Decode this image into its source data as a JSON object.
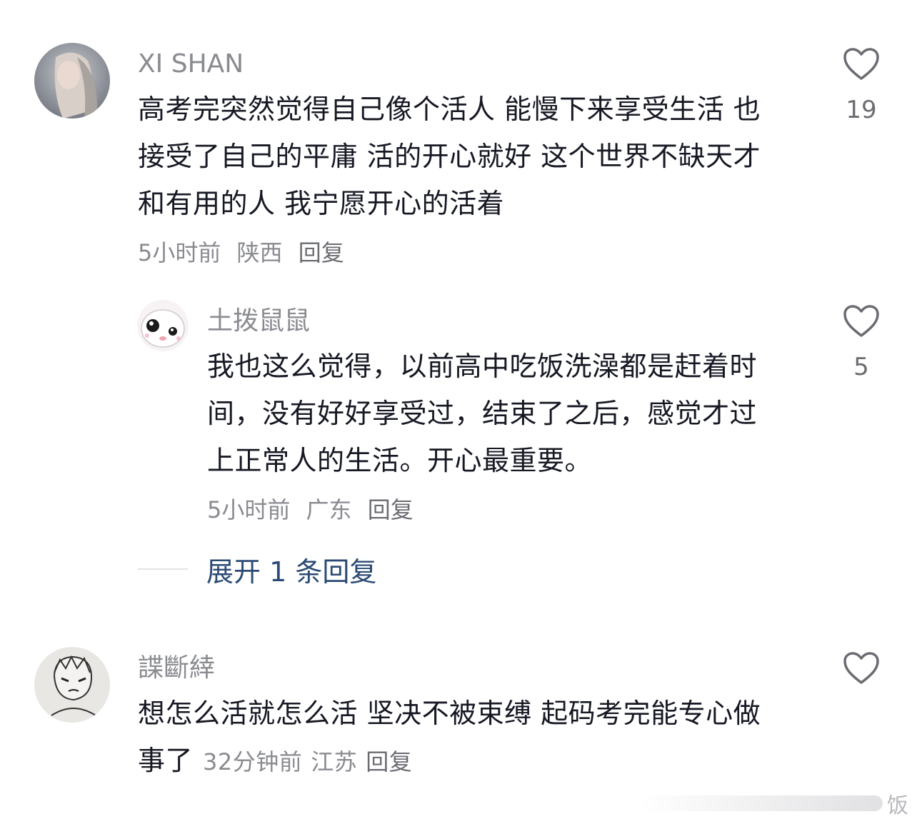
{
  "comments": [
    {
      "username": "XI SHAN",
      "text": "高考完突然觉得自己像个活人  能慢下来享受生活 也接受了自己的平庸 活的开心就好 这个世界不缺天才 和有用的人 我宁愿开心的活着",
      "time": "5小时前",
      "location": "陕西",
      "reply_label": "回复",
      "likes": "19"
    },
    {
      "username": "土拨鼠鼠",
      "text": "我也这么觉得，以前高中吃饭洗澡都是赶着时间，没有好好享受过，结束了之后，感觉才过上正常人的生活。开心最重要。",
      "time": "5小时前",
      "location": "广东",
      "reply_label": "回复",
      "likes": "5"
    },
    {
      "username": "諜斷緈",
      "text": "想怎么活就怎么活 坚决不被束缚 起码考完能专心做事了",
      "time": "32分钟前",
      "location": "江苏",
      "reply_label": "回复",
      "likes": ""
    }
  ],
  "expand_replies_label": "展开 1 条回复",
  "watermark_text": "饭",
  "colors": {
    "text_primary": "#161823",
    "text_secondary": "#8a8b91",
    "expand_link": "#2b4a73"
  },
  "icons": {
    "like": "heart-outline-icon"
  }
}
